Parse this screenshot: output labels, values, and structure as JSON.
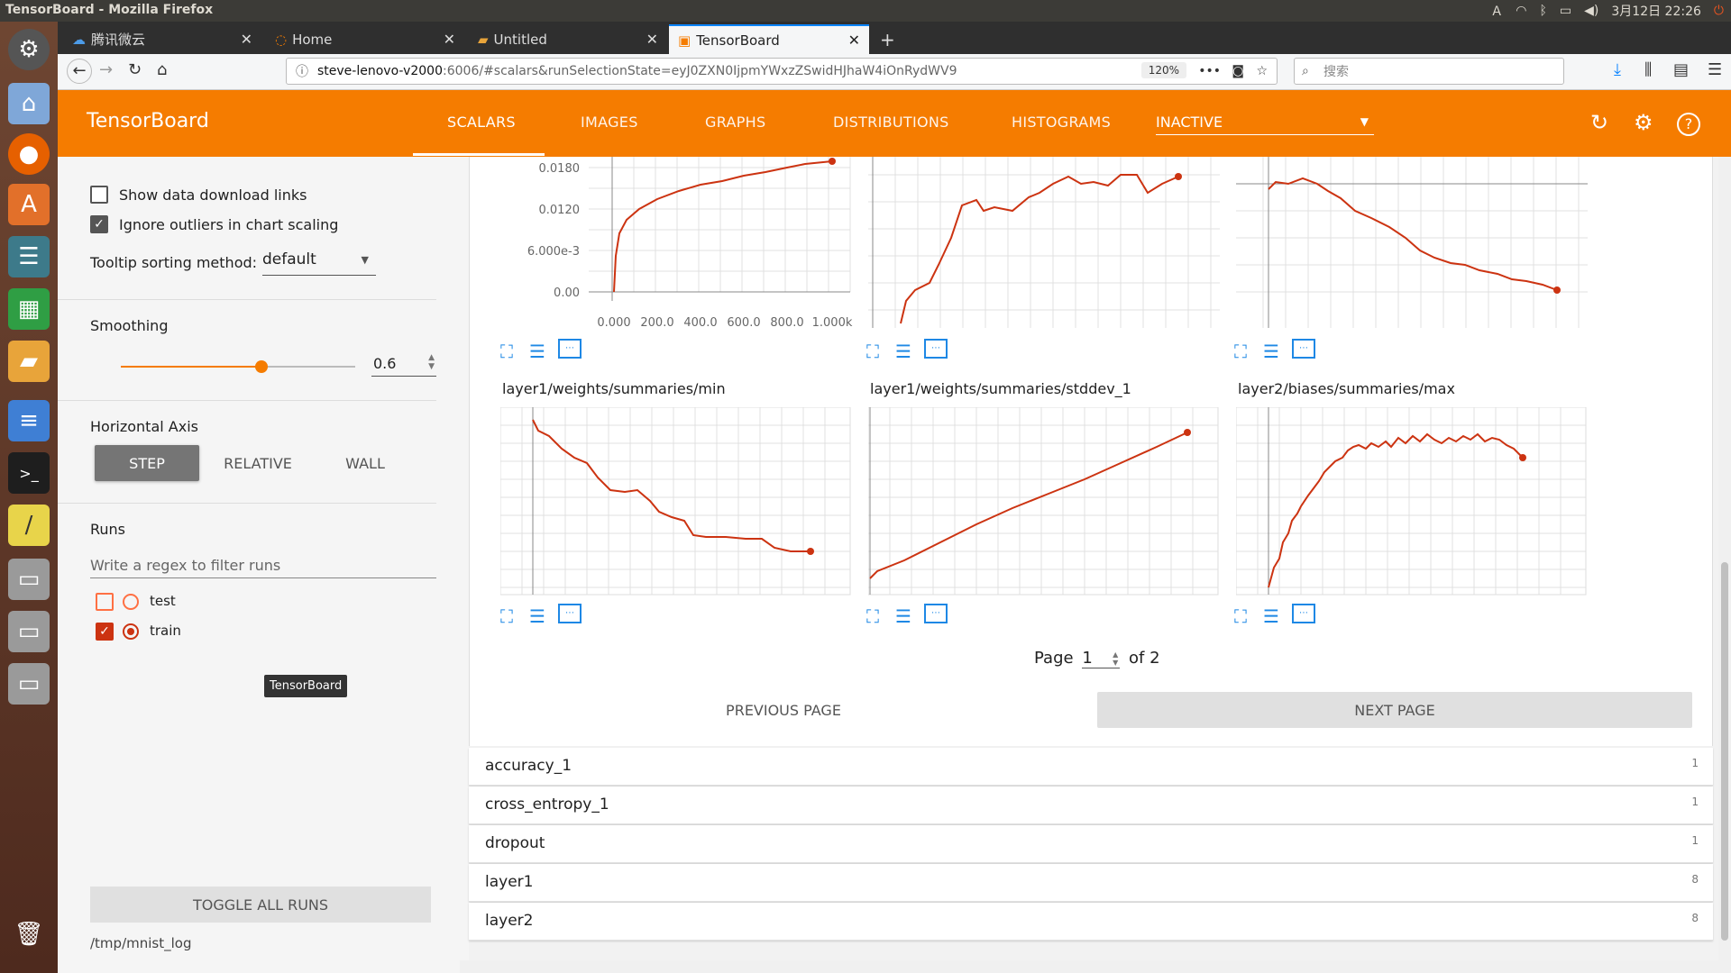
{
  "system": {
    "window_title": "TensorBoard - Mozilla Firefox",
    "clock": "3月12日 22:26"
  },
  "browser": {
    "tabs": [
      {
        "label": "腾讯微云"
      },
      {
        "label": "Home"
      },
      {
        "label": "Untitled"
      },
      {
        "label": "TensorBoard"
      }
    ],
    "url_host": "steve-lenovo-v2000",
    "url_rest": ":6006/#scalars&runSelectionState=eyJ0ZXN0IjpmYWxzZSwidHJhaW4iOnRydWV9",
    "zoom": "120%",
    "search_placeholder": "搜索"
  },
  "tensorboard": {
    "brand": "TensorBoard",
    "tabs": [
      "SCALARS",
      "IMAGES",
      "GRAPHS",
      "DISTRIBUTIONS",
      "HISTOGRAMS"
    ],
    "active_tab": "SCALARS",
    "inactive_select": "INACTIVE"
  },
  "sidebar": {
    "show_download_links": "Show data download links",
    "ignore_outliers": "Ignore outliers in chart scaling",
    "tooltip_sorting_label": "Tooltip sorting method:",
    "tooltip_sorting_value": "default",
    "smoothing_label": "Smoothing",
    "smoothing_value": "0.6",
    "smoothing_fraction": 0.6,
    "horizontal_axis_label": "Horizontal Axis",
    "axis_buttons": [
      "STEP",
      "RELATIVE",
      "WALL"
    ],
    "runs_label": "Runs",
    "runs_filter_placeholder": "Write a regex to filter runs",
    "runs": [
      {
        "name": "test",
        "checked": false,
        "color": "#ff7043"
      },
      {
        "name": "train",
        "checked": true,
        "color": "#cc3311"
      }
    ],
    "toggle_all_runs": "TOGGLE ALL RUNS",
    "log_dir": "/tmp/mnist_log",
    "tooltip": "TensorBoard"
  },
  "charts": {
    "top_row_yticks": [
      "0.0180",
      "0.0120",
      "6.000e-3",
      "0.00"
    ],
    "top_row_xticks": [
      "0.000",
      "200.0",
      "400.0",
      "600.0",
      "800.0",
      "1.000k"
    ],
    "titles": [
      "layer1/weights/summaries/min",
      "layer1/weights/summaries/stddev_1",
      "layer2/biases/summaries/max"
    ]
  },
  "pagination": {
    "page_label": "Page",
    "page_value": "1",
    "of_label": "of 2",
    "prev": "PREVIOUS PAGE",
    "next": "NEXT PAGE"
  },
  "categories": [
    {
      "name": "accuracy_1",
      "count": "1"
    },
    {
      "name": "cross_entropy_1",
      "count": "1"
    },
    {
      "name": "dropout",
      "count": "1"
    },
    {
      "name": "layer1",
      "count": "8"
    },
    {
      "name": "layer2",
      "count": "8"
    }
  ],
  "colors": {
    "accent": "#f57c00",
    "series": "#cc3311",
    "control_blue": "#1e88e5"
  }
}
